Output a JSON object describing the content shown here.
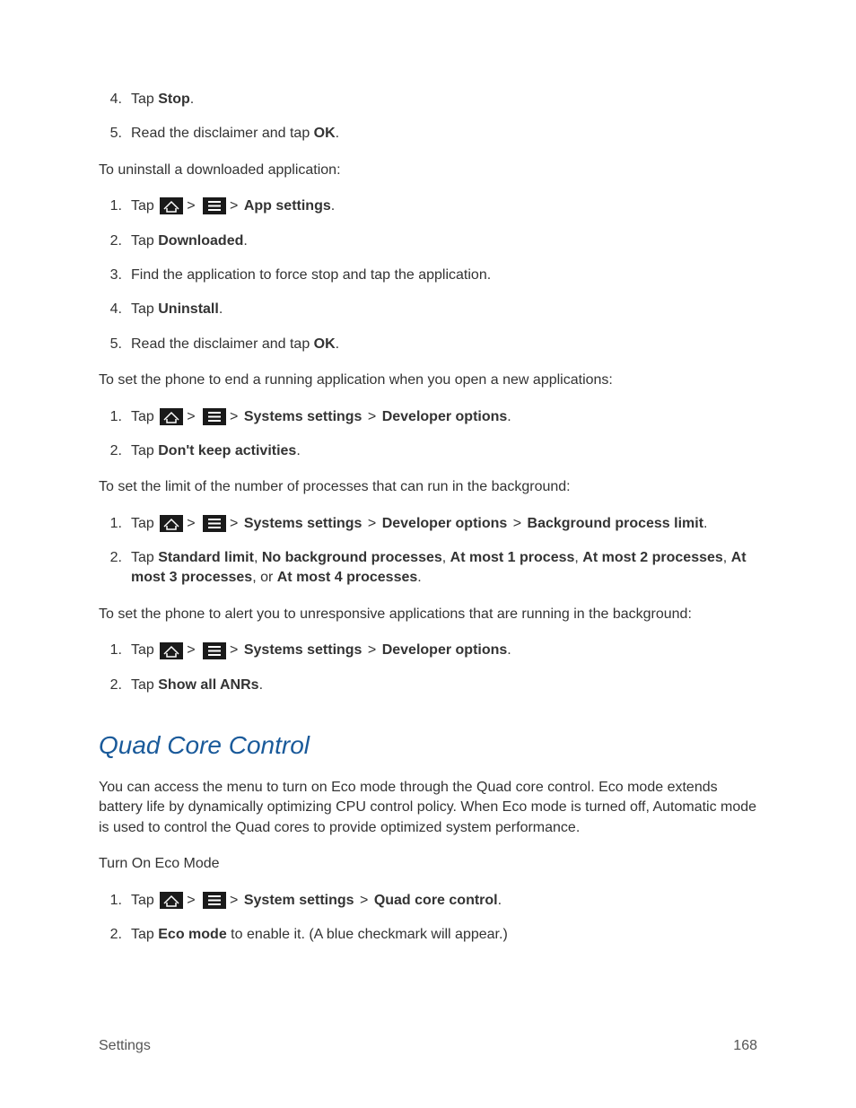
{
  "list1": {
    "items": [
      {
        "num": "4.",
        "prefix": "Tap ",
        "bold": "Stop",
        "suffix": "."
      },
      {
        "num": "5.",
        "prefix": "Read the disclaimer and tap ",
        "bold": "OK",
        "suffix": "."
      }
    ]
  },
  "para1": "To uninstall a downloaded application:",
  "list2": {
    "step1": {
      "num": "1.",
      "tap": "Tap ",
      "sep": ">",
      "bold": "App settings",
      "suffix": "."
    },
    "items": [
      {
        "num": "2.",
        "prefix": "Tap ",
        "bold": "Downloaded",
        "suffix": "."
      },
      {
        "num": "3.",
        "prefix": "Find the application to force stop and tap the application.",
        "bold": "",
        "suffix": ""
      },
      {
        "num": "4.",
        "prefix": "Tap ",
        "bold": "Uninstall",
        "suffix": "."
      },
      {
        "num": "5.",
        "prefix": "Read the disclaimer and tap ",
        "bold": "OK",
        "suffix": "."
      }
    ]
  },
  "para2": "To set the phone to end a running application when you open a new applications:",
  "list3": {
    "step1": {
      "num": "1.",
      "tap": "Tap ",
      "sep": ">",
      "b1": "Systems settings",
      "b2": "Developer options",
      "suffix": "."
    },
    "step2": {
      "num": "2.",
      "prefix": "Tap ",
      "bold": "Don't keep activities",
      "suffix": "."
    }
  },
  "para3": "To set the limit of the number of processes that can run in the background:",
  "list4": {
    "step1": {
      "num": "1.",
      "tap": "Tap ",
      "sep": ">",
      "b1": "Systems settings",
      "b2": "Developer options",
      "b3": "Background process limit",
      "suffix": "."
    },
    "step2": {
      "num": "2.",
      "prefix": "Tap ",
      "b1": "Standard limit",
      "c1": ", ",
      "b2": "No background processes",
      "c2": ", ",
      "b3": "At most 1 process",
      "c3": ", ",
      "b4": "At most 2 processes",
      "c4": ", ",
      "b5": "At most 3 processes",
      "c5": ", or ",
      "b6": "At most 4 processes",
      "suffix": "."
    }
  },
  "para4": "To set the phone to alert you to unresponsive applications that are running in the background:",
  "list5": {
    "step1": {
      "num": "1.",
      "tap": "Tap ",
      "sep": ">",
      "b1": "Systems settings",
      "b2": "Developer options",
      "suffix": "."
    },
    "step2": {
      "num": "2.",
      "prefix": "Tap ",
      "bold": "Show all ANRs",
      "suffix": "."
    }
  },
  "section_title": "Quad Core Control",
  "para5": "You can access the menu to turn on Eco mode through the Quad core control. Eco mode extends battery life by dynamically optimizing CPU control policy. When Eco mode is turned off, Automatic mode is used to control the Quad cores to provide optimized system performance.",
  "para6": "Turn On Eco Mode",
  "list6": {
    "step1": {
      "num": "1.",
      "tap": "Tap ",
      "sep": ">",
      "b1": "System settings",
      "b2": "Quad core control",
      "suffix": "."
    },
    "step2": {
      "num": "2.",
      "prefix": "Tap ",
      "bold": "Eco mode",
      "suffix": " to enable it. (A blue checkmark will appear.)"
    }
  },
  "footer": {
    "left": "Settings",
    "right": "168"
  }
}
